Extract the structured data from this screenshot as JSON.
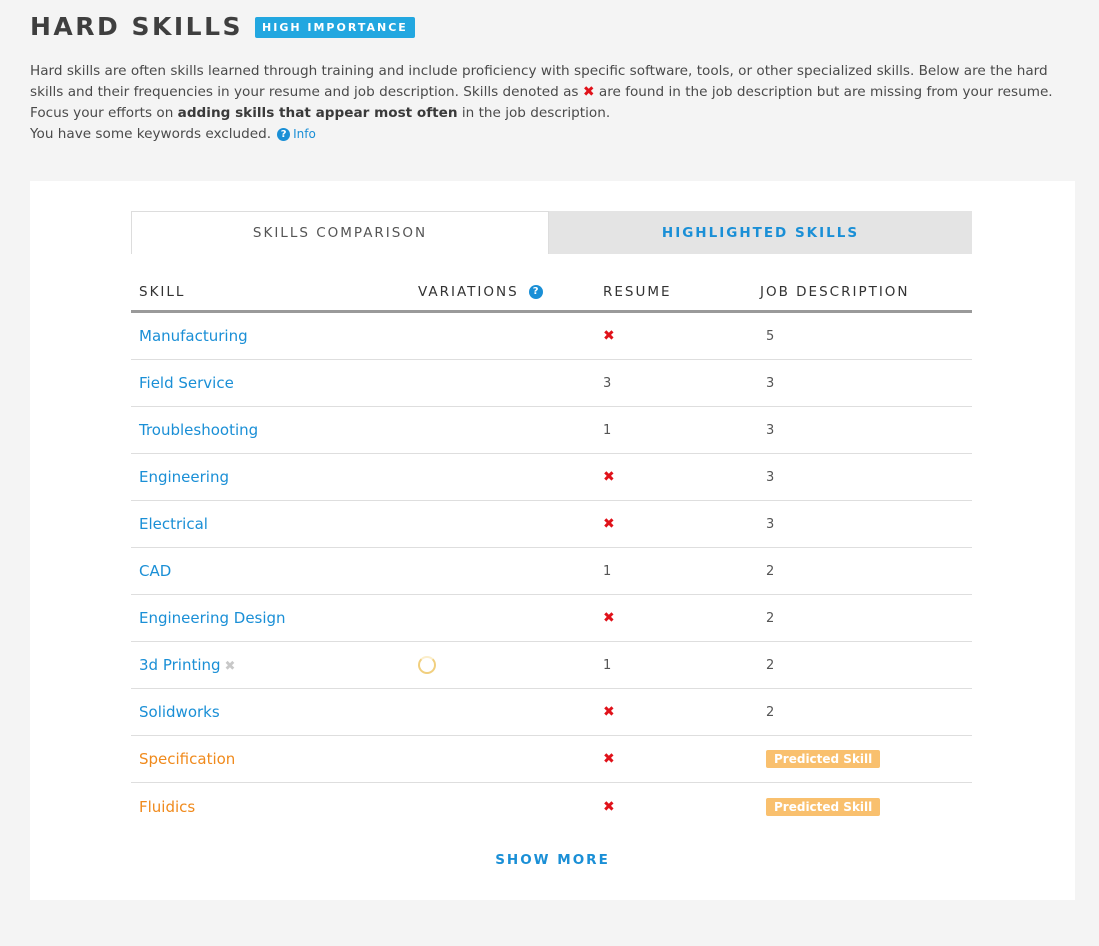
{
  "header": {
    "title": "HARD SKILLS",
    "badge": "HIGH IMPORTANCE"
  },
  "description": {
    "part1": "Hard skills are often skills learned through training and include proficiency with specific software, tools, or other specialized skills. Below are the hard skills and their frequencies in your resume and job description. Skills denoted as ",
    "missing_icon": "✖",
    "part2": " are found in the job description but are missing from your resume. Focus your efforts on ",
    "bold": "adding skills that appear most often",
    "part3": " in the job description.",
    "excluded": "You have some keywords excluded.",
    "info_icon": "?",
    "info_link": "Info"
  },
  "tabs": {
    "comparison": "SKILLS COMPARISON",
    "highlighted": "HIGHLIGHTED SKILLS"
  },
  "table": {
    "headers": {
      "skill": "SKILL",
      "variations": "VARIATIONS",
      "variations_help": "?",
      "resume": "RESUME",
      "job": "JOB DESCRIPTION"
    },
    "rows": [
      {
        "skill": "Manufacturing",
        "resume": "✖",
        "job": "5"
      },
      {
        "skill": "Field Service",
        "resume": "3",
        "job": "3"
      },
      {
        "skill": "Troubleshooting",
        "resume": "1",
        "job": "3"
      },
      {
        "skill": "Engineering",
        "resume": "✖",
        "job": "3"
      },
      {
        "skill": "Electrical",
        "resume": "✖",
        "job": "3"
      },
      {
        "skill": "CAD",
        "resume": "1",
        "job": "2"
      },
      {
        "skill": "Engineering Design",
        "resume": "✖",
        "job": "2"
      },
      {
        "skill": "3d Printing",
        "remove_icon": "✖",
        "resume": "1",
        "job": "2"
      },
      {
        "skill": "Solidworks",
        "resume": "✖",
        "job": "2"
      },
      {
        "skill": "Specification",
        "resume": "✖",
        "job": "Predicted Skill"
      },
      {
        "skill": "Fluidics",
        "resume": "✖",
        "job": "Predicted Skill"
      }
    ]
  },
  "show_more": "SHOW MORE",
  "colors": {
    "accent": "#1a8fd6",
    "badge": "#22a7e0",
    "missing": "#e0121a",
    "predicted_text": "#f08a1c",
    "predicted_badge": "#f9c06e"
  }
}
